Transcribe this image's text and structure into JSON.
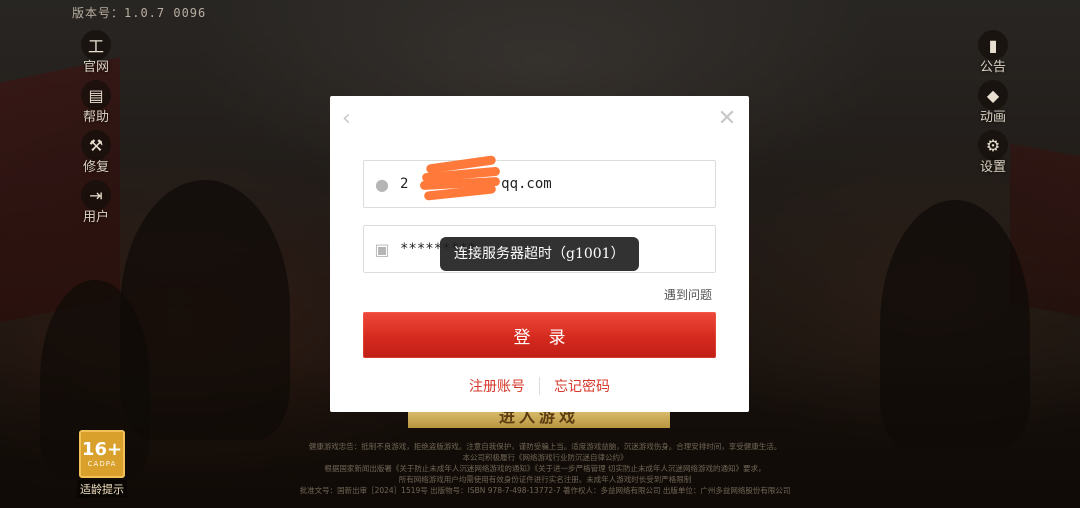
{
  "version": "版本号：1.0.7 0096",
  "left_menu": [
    {
      "label": "官网",
      "icon": "temple-icon"
    },
    {
      "label": "帮助",
      "icon": "book-icon"
    },
    {
      "label": "修复",
      "icon": "wrench-icon"
    },
    {
      "label": "用户",
      "icon": "logout-icon"
    }
  ],
  "right_menu": [
    {
      "label": "公告",
      "icon": "bookmark-icon"
    },
    {
      "label": "动画",
      "icon": "play-icon"
    },
    {
      "label": "设置",
      "icon": "gear-icon"
    }
  ],
  "age_rating": {
    "number": "16+",
    "sub": "CADPA",
    "label": "适龄提示"
  },
  "login": {
    "username_value": "2           qq.com",
    "password_value": "*********",
    "help_link": "遇到问题",
    "login_button": "登录",
    "register_link": "注册账号",
    "forgot_link": "忘记密码"
  },
  "toast": "连接服务器超时（g1001）",
  "behind_button": "进入游戏",
  "notice_lines": [
    "健康游戏忠告：抵制不良游戏，拒绝盗版游戏。注意自我保护，谨防受骗上当。适度游戏益脑，沉迷游戏伤身。合理安排时间，享受健康生活。",
    "本公司积极履行《网络游戏行业防沉迷自律公约》",
    "根据国家新闻出版署《关于防止未成年人沉迷网络游戏的通知》《关于进一步严格管理 切实防止未成年人沉迷网络游戏的通知》要求，",
    "所有网络游戏用户均需使用有效身份证件进行实名注册。未成年人游戏时长受到严格限制",
    "批准文号：国新出审［2024］1519号  出版物号：ISBN 978-7-498-13772-7  著作权人：多益网络有限公司  出版单位：广州多益网络股份有限公司"
  ],
  "colors": {
    "accent_red": "#d52a1f",
    "link_red": "#d5382b",
    "redaction": "#ff7a3a"
  }
}
